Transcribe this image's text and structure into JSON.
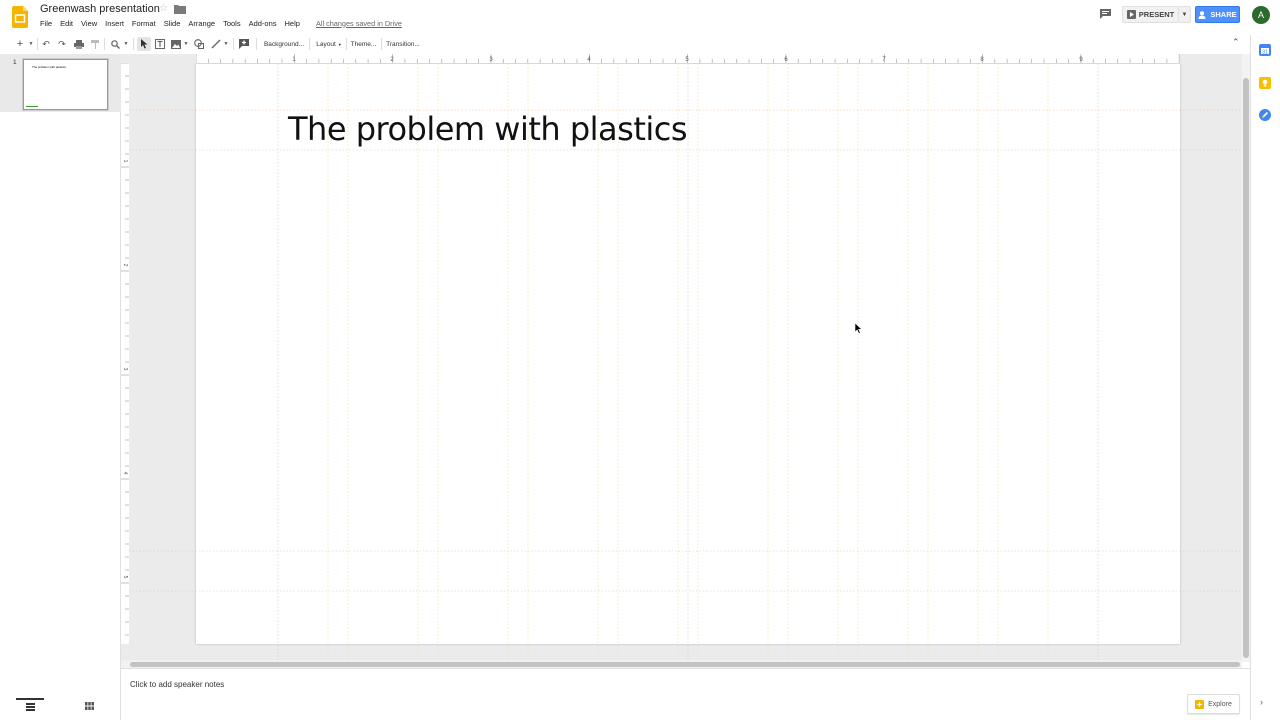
{
  "app": {
    "title": "Greenwash presentation",
    "save_status": "All changes saved in Drive",
    "brand_color": "#f4b400"
  },
  "menu": [
    "File",
    "Edit",
    "View",
    "Insert",
    "Format",
    "Slide",
    "Arrange",
    "Tools",
    "Add-ons",
    "Help"
  ],
  "header": {
    "present_label": "PRESENT",
    "share_label": "SHARE",
    "avatar_letter": "A",
    "share_color": "#4d90fe"
  },
  "toolbar": {
    "background_label": "Background...",
    "layout_label": "Layout",
    "theme_label": "Theme...",
    "transition_label": "Transition..."
  },
  "ruler": {
    "h_labels": [
      "1",
      "2",
      "3",
      "4",
      "5",
      "6",
      "7",
      "8",
      "9"
    ],
    "v_labels": [
      "1",
      "2",
      "3",
      "4",
      "5"
    ]
  },
  "filmstrip": {
    "slides": [
      {
        "number": "1",
        "thumb_text": "The problem with plastics"
      }
    ]
  },
  "slide": {
    "title": "The problem with plastics"
  },
  "notes": {
    "placeholder": "Click to add speaker notes"
  },
  "explore": {
    "label": "Explore"
  }
}
